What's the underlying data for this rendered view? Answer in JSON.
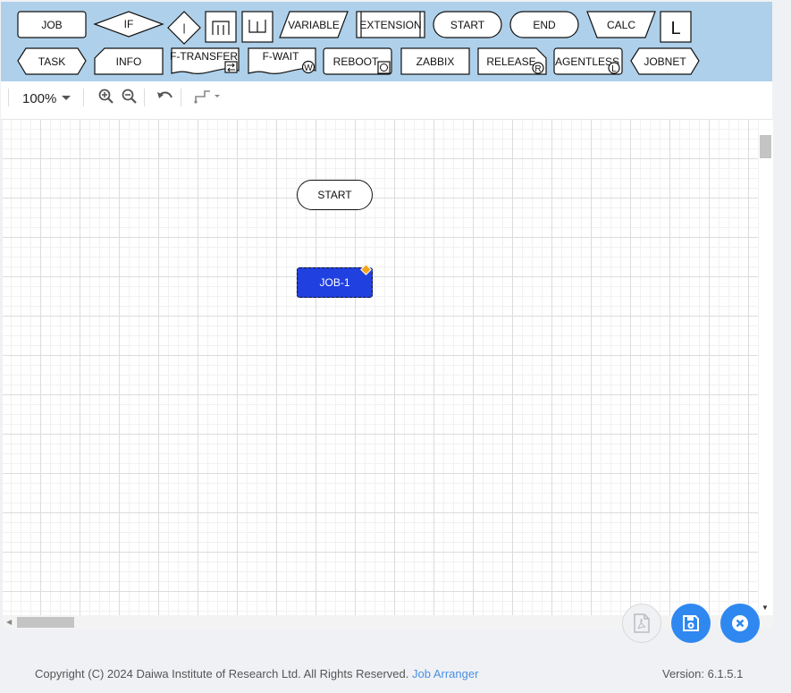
{
  "palette": {
    "job": "JOB",
    "if": "IF",
    "branch": "|",
    "loop_open": "ϖ",
    "loop_close": "Ш",
    "variable": "VARIABLE",
    "extension": "EXTENSION",
    "start": "START",
    "end": "END",
    "calc": "CALC",
    "loop": "L",
    "task": "TASK",
    "info": "INFO",
    "ftransfer": "F-TRANSFER",
    "fwait": "F-WAIT",
    "fwait_badge": "W",
    "reboot": "REBOOT",
    "zabbix": "ZABBIX",
    "release": "RELEASE",
    "release_badge": "R",
    "agentless": "AGENTLESS",
    "agentless_badge": "L",
    "jobnet": "JOBNET"
  },
  "toolbar": {
    "zoom": "100%"
  },
  "canvas": {
    "start_label": "START",
    "job_label": "JOB-1"
  },
  "footer": {
    "copyright": "Copyright (C) 2024 Daiwa Institute of Research Ltd. All Rights Reserved.",
    "product": "Job Arranger",
    "version": "Version: 6.1.5.1"
  },
  "colors": {
    "palette_bg": "#aed0ea",
    "selected_job": "#2040e0",
    "accent": "#2f88f0",
    "handle": "#f3a51c"
  }
}
